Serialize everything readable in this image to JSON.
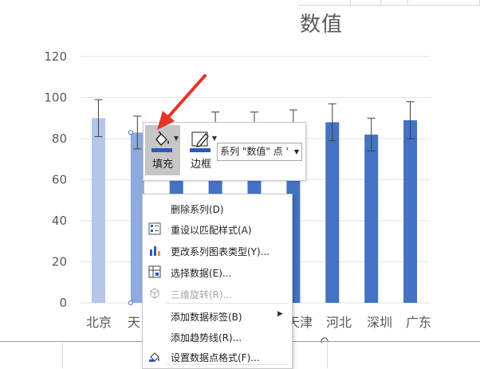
{
  "chart_data": {
    "type": "bar",
    "title": "数值",
    "categories": [
      "北京",
      "天津",
      "",
      "",
      "",
      "天津",
      "河北",
      "深圳",
      "广东"
    ],
    "category_labels_visible": [
      "北京",
      "天",
      "天津",
      "河北",
      "深圳",
      "广东"
    ],
    "values": [
      90,
      83,
      76,
      78,
      79,
      78,
      88,
      82,
      89
    ],
    "error_plus": [
      9,
      8,
      8,
      15,
      14,
      16,
      9,
      8,
      9
    ],
    "error_minus": [
      9,
      8,
      8,
      10,
      10,
      10,
      9,
      8,
      9
    ],
    "ylim": [
      0,
      120
    ],
    "yticks": [
      0,
      20,
      40,
      60,
      80,
      100,
      120
    ],
    "grid": true,
    "colors": {
      "bar": "#4472c4",
      "bar_faded": "#b4c7e7",
      "bar_selected": "#8faadc"
    }
  },
  "mini_toolbar": {
    "fill_label": "填充",
    "border_label": "边框",
    "series_select": "系列 \"数值\" 点 '"
  },
  "context_menu": {
    "items": [
      {
        "label": "删除系列(D)",
        "icon": "",
        "disabled": false
      },
      {
        "label": "重设以匹配样式(A)",
        "icon": "reset-style-icon",
        "disabled": false
      },
      {
        "label": "更改系列图表类型(Y)...",
        "icon": "chart-type-icon",
        "disabled": false
      },
      {
        "label": "选择数据(E)...",
        "icon": "select-data-icon",
        "disabled": false
      },
      {
        "label": "三维旋转(R)...",
        "icon": "rotate-3d-icon",
        "disabled": true
      },
      {
        "label": "添加数据标签(B)",
        "icon": "",
        "disabled": false,
        "submenu": true
      },
      {
        "label": "添加趋势线(R)...",
        "icon": "",
        "disabled": false
      },
      {
        "label": "设置数据点格式(F)...",
        "icon": "format-data-point-icon",
        "disabled": false
      }
    ]
  },
  "colors": {
    "accent": "#2f58b8",
    "annotation_arrow": "#e8332a"
  }
}
